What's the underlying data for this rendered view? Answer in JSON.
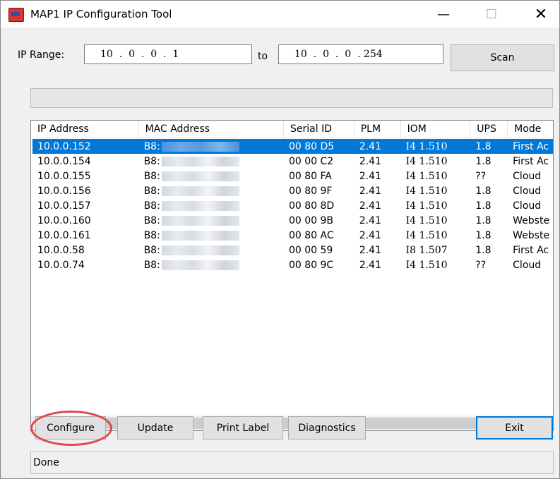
{
  "window": {
    "title": "MAP1 IP Configuration Tool",
    "icon": "app-logo-icon",
    "minimize_glyph": "—",
    "maximize_glyph": "☐",
    "close_glyph": "✕"
  },
  "ip_range": {
    "label": "IP Range:",
    "from": "10  .  0  .  0  .  1",
    "to_label": "to",
    "to": "10  .  0  .  0  . 254"
  },
  "buttons": {
    "scan": "Scan",
    "configure": "Configure",
    "update": "Update",
    "print_label": "Print Label",
    "diagnostics": "Diagnostics",
    "exit": "Exit"
  },
  "table": {
    "columns": [
      "IP Address",
      "MAC Address",
      "Serial ID",
      "PLM",
      "IOM",
      "UPS",
      "Mode"
    ],
    "rows": [
      {
        "ip": "10.0.0.152",
        "mac": "B8:",
        "serial": "00 80 D5",
        "plm": "2.41",
        "iom": "I4 1.510",
        "ups": "1.8",
        "mode": "First Ac",
        "selected": true
      },
      {
        "ip": "10.0.0.154",
        "mac": "B8:",
        "serial": "00 00 C2",
        "plm": "2.41",
        "iom": "I4 1.510",
        "ups": "1.8",
        "mode": "First Ac"
      },
      {
        "ip": "10.0.0.155",
        "mac": "B8:",
        "serial": "00 80 FA",
        "plm": "2.41",
        "iom": "I4 1.510",
        "ups": "??",
        "mode": "Cloud"
      },
      {
        "ip": "10.0.0.156",
        "mac": "B8:",
        "serial": "00 80 9F",
        "plm": "2.41",
        "iom": "I4 1.510",
        "ups": "1.8",
        "mode": "Cloud"
      },
      {
        "ip": "10.0.0.157",
        "mac": "B8:",
        "serial": "00 80 8D",
        "plm": "2.41",
        "iom": "I4 1.510",
        "ups": "1.8",
        "mode": "Cloud"
      },
      {
        "ip": "10.0.0.160",
        "mac": "B8:",
        "serial": "00 00 9B",
        "plm": "2.41",
        "iom": "I4 1.510",
        "ups": "1.8",
        "mode": "Webste"
      },
      {
        "ip": "10.0.0.161",
        "mac": "B8:",
        "serial": "00 80 AC",
        "plm": "2.41",
        "iom": "I4 1.510",
        "ups": "1.8",
        "mode": "Webste"
      },
      {
        "ip": "10.0.0.58",
        "mac": "B8:",
        "serial": "00 00 59",
        "plm": "2.41",
        "iom": "I8 1.507",
        "ups": "1.8",
        "mode": "First Ac"
      },
      {
        "ip": "10.0.0.74",
        "mac": "B8:",
        "serial": "00 80 9C",
        "plm": "2.41",
        "iom": "I4 1.510",
        "ups": "??",
        "mode": "Cloud"
      }
    ]
  },
  "scrollbar": {
    "left_glyph": "<",
    "right_glyph": ">"
  },
  "status": {
    "text": "Done"
  },
  "colors": {
    "selection": "#0078d7",
    "highlight_ring": "#e0464c"
  }
}
